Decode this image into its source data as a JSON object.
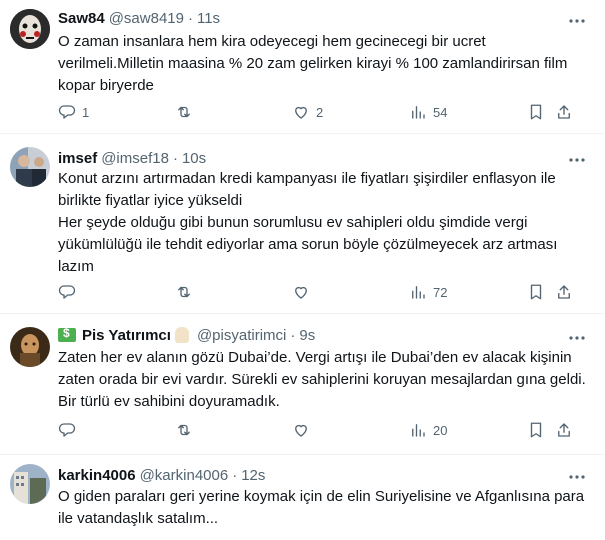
{
  "tweets": [
    {
      "name": "Saw84",
      "handle": "@saw8419",
      "dot": "·",
      "time": "11s",
      "text": "O zaman insanlara hem kira odeyecegi hem gecinecegi bir ucret verilmeli.Milletin maasina % 20 zam gelirken kirayi % 100 zamlandirirsan film kopar biryerde",
      "replies": "1",
      "retweets": "",
      "likes": "2",
      "views": "54",
      "avatar_color": "#1a1a1a"
    },
    {
      "name": "imsef",
      "handle": "@imsef18",
      "dot": "·",
      "time": "10s",
      "text": "Konut arzını artırmadan kredi kampanyası ile fiyatları şişirdiler enflasyon ile birlikte fiyatlar iyice yükseldi\nHer şeyde olduğu gibi bunun sorumlusu ev sahipleri oldu şimdide vergi yükümlülüğü ile tehdit ediyorlar ama sorun böyle çözülmeyecek arz artması lazım",
      "replies": "",
      "retweets": "",
      "likes": "",
      "views": "72",
      "avatar_color": "#6b7b8c"
    },
    {
      "name": "Pis Yatırımcı",
      "handle": "@pisyatirimci",
      "dot": "·",
      "time": "9s",
      "text": "Zaten her ev alanın gözü Dubai’de. Vergi artışı ile Dubai’den ev alacak kişinin zaten orada bir evi vardır. Sürekli ev sahiplerini koruyan mesajlardan gına geldi. Bir türlü ev sahibini doyuramadık.",
      "replies": "",
      "retweets": "",
      "likes": "",
      "views": "20",
      "avatar_color": "#8a6a3a"
    },
    {
      "name": "karkin4006",
      "handle": "@karkin4006",
      "dot": "·",
      "time": "12s",
      "text": "O giden paraları geri yerine koymak için de elin Suriyelisine ve Afganlısına para ile vatandaşlık satalım...",
      "avatar_color": "#5d6b55"
    }
  ],
  "icons": {
    "more": "more-icon",
    "reply": "reply-icon",
    "retweet": "retweet-icon",
    "like": "like-icon",
    "views": "views-icon",
    "bookmark": "bookmark-icon",
    "share": "share-icon"
  }
}
